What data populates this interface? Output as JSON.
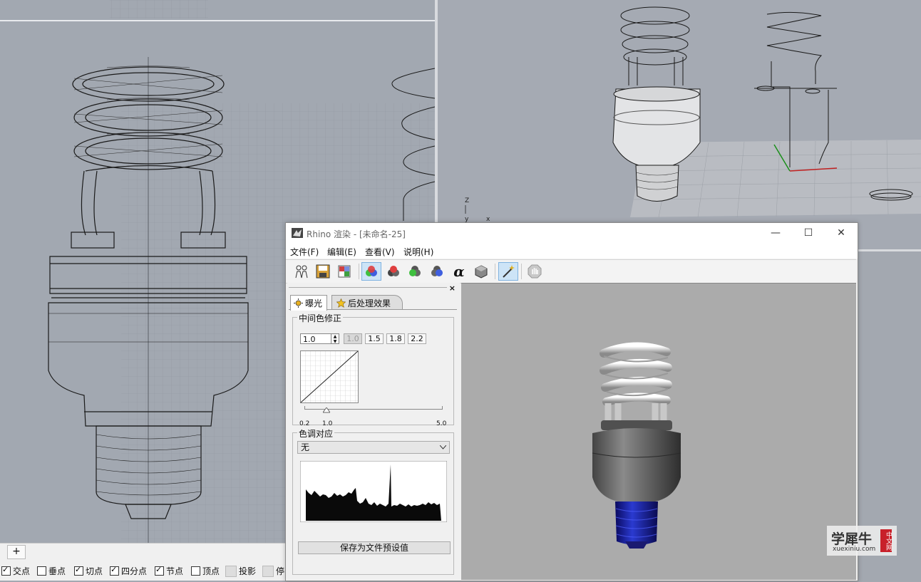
{
  "viewports": {
    "front_axes": [
      "Z",
      "y",
      "x"
    ]
  },
  "status_bar": {
    "add_tab_label": "+",
    "snaps": [
      {
        "label": "交点",
        "checked": true
      },
      {
        "label": "垂点",
        "checked": false
      },
      {
        "label": "切点",
        "checked": true
      },
      {
        "label": "四分点",
        "checked": true
      },
      {
        "label": "节点",
        "checked": true
      },
      {
        "label": "顶点",
        "checked": false
      },
      {
        "label": "投影",
        "checked": false
      },
      {
        "label": "停",
        "checked": false
      }
    ]
  },
  "render_window": {
    "title": "Rhino 渲染 - [未命名-25]",
    "window_buttons": {
      "minimize": "—",
      "maximize": "☐",
      "close": "✕"
    },
    "menu": [
      "文件(F)",
      "编辑(E)",
      "查看(V)",
      "说明(H)"
    ],
    "toolbar_icons": [
      "clone-window-icon",
      "save-icon",
      "channels-icon",
      "color-channel-rgb-icon",
      "red-channel-icon",
      "green-channel-icon",
      "blue-channel-icon",
      "alpha-channel-icon",
      "depth-channel-icon",
      "post-effects-wand-icon",
      "stop-render-icon"
    ],
    "panel": {
      "close_label": "×",
      "tabs": [
        "曝光",
        "后处理效果"
      ],
      "gamma": {
        "group_label": "中间色修正",
        "value": "1.0",
        "presets": [
          "1.0",
          "1.5",
          "1.8",
          "2.2"
        ],
        "slider_min": "0.2",
        "slider_mid": "1.0",
        "slider_max": "5.0"
      },
      "tone": {
        "group_label": "色调对应",
        "selected": "无",
        "save_button": "保存为文件预设值"
      }
    }
  },
  "watermark": {
    "main": "学犀牛",
    "url": "xuexiniu.com",
    "badge": "中文网"
  },
  "colors": {
    "viewport_bg": "#a2a8b1",
    "render_bg": "#ababab",
    "active_tool": "#cde4f7"
  }
}
